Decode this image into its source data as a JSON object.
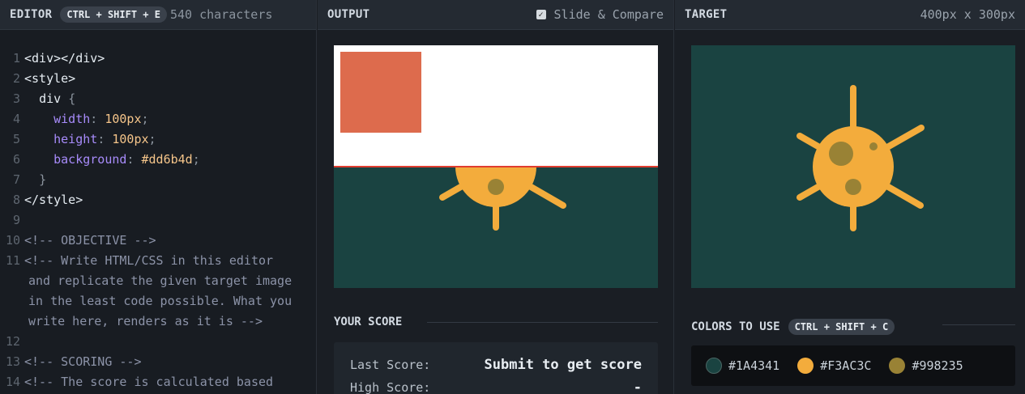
{
  "editor": {
    "title": "EDITOR",
    "shortcut": "CTRL + SHIFT + E",
    "char_count": "540 characters",
    "lines": [
      {
        "num": "1"
      },
      {
        "num": "2"
      },
      {
        "num": "3"
      },
      {
        "num": "4"
      },
      {
        "num": "5"
      },
      {
        "num": "6"
      },
      {
        "num": "7"
      },
      {
        "num": "8"
      },
      {
        "num": "9"
      },
      {
        "num": "10"
      },
      {
        "num": "11"
      },
      {
        "num": "12"
      },
      {
        "num": "13"
      },
      {
        "num": "14"
      }
    ],
    "code": {
      "l1_open": "<div>",
      "l1_close": "</div>",
      "l2": "<style>",
      "l3_sel": "div",
      "l3_brace": "{",
      "l4_prop": "width",
      "l4_val": "100px",
      "l5_prop": "height",
      "l5_val": "100px",
      "l6_prop": "background",
      "l6_val": "#dd6b4d",
      "l7": "}",
      "l8": "</style>",
      "l10": "<!-- OBJECTIVE -->",
      "l11a": "<!-- Write HTML/CSS in this editor",
      "l11b": "and replicate the given target image",
      "l11c": "in the least code possible. What you",
      "l11d": "write here, renders as it is -->",
      "l13": "<!-- SCORING -->",
      "l14": "<!-- The score is calculated based"
    }
  },
  "output": {
    "title": "OUTPUT",
    "slide_compare_label": "Slide & Compare",
    "slide_compare_checked": true,
    "score_title": "YOUR SCORE",
    "last_score_label": "Last Score:",
    "last_score_value": "Submit to get score",
    "high_score_label": "High Score:",
    "high_score_value": "-"
  },
  "target": {
    "title": "TARGET",
    "dimensions": "400px x 300px",
    "colors_title": "COLORS TO USE",
    "colors_shortcut": "CTRL + SHIFT + C",
    "colors": [
      {
        "label": "#1A4341",
        "hex": "#1A4341"
      },
      {
        "label": "#F3AC3C",
        "hex": "#F3AC3C"
      },
      {
        "label": "#998235",
        "hex": "#998235"
      }
    ]
  },
  "theme": {
    "background": "#1A4341",
    "sun": "#F3AC3C",
    "spot": "#998235",
    "output_square": "#dd6b4d",
    "compare_divider": "#e03c2f"
  }
}
